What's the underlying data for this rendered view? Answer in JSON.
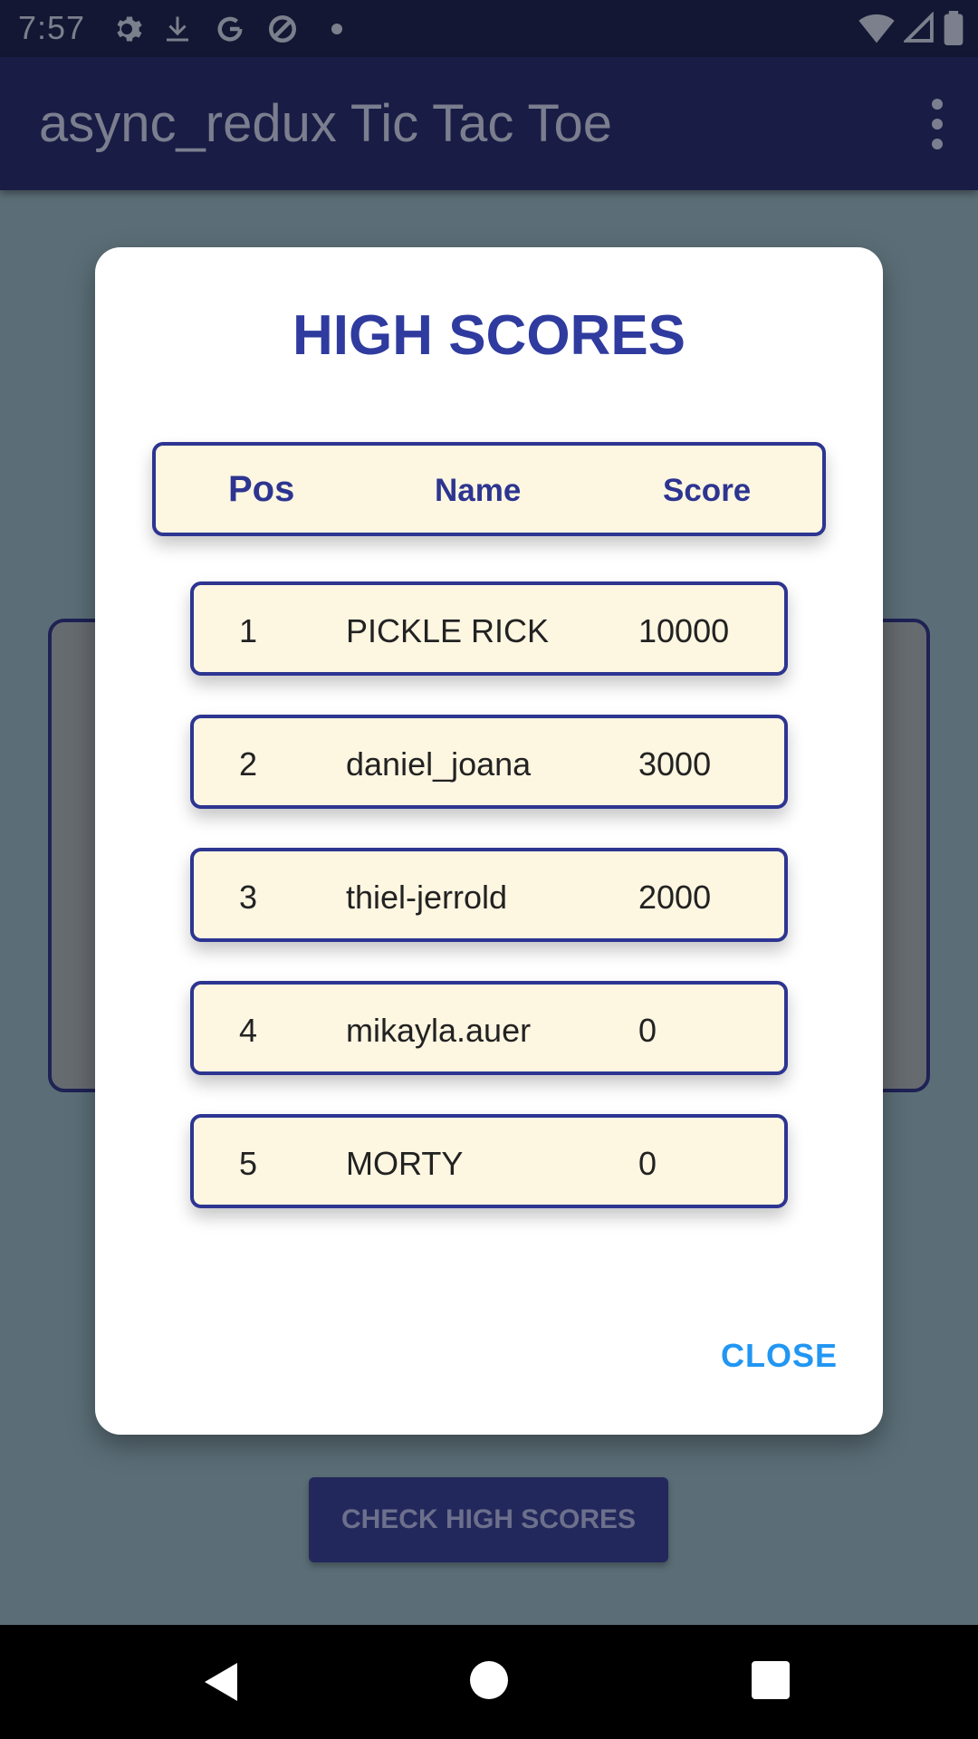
{
  "status_bar": {
    "time": "7:57",
    "left_icons": [
      "gear-icon",
      "download-icon",
      "google-icon",
      "data-saver-icon",
      "dot-icon"
    ],
    "right_icons": [
      "wifi-icon",
      "signal-icon",
      "battery-icon"
    ]
  },
  "app_bar": {
    "title": "async_redux Tic Tac Toe",
    "menu_icon": "more-vert-icon"
  },
  "background": {
    "button_label": "CHECK HIGH SCORES"
  },
  "dialog": {
    "title": "HIGH SCORES",
    "headers": {
      "pos": "Pos",
      "name": "Name",
      "score": "Score"
    },
    "rows": [
      {
        "pos": "1",
        "name": "PICKLE RICK",
        "score": "10000"
      },
      {
        "pos": "2",
        "name": "daniel_joana",
        "score": "3000"
      },
      {
        "pos": "3",
        "name": "thiel-jerrold",
        "score": "2000"
      },
      {
        "pos": "4",
        "name": "mikayla.auer",
        "score": "0"
      },
      {
        "pos": "5",
        "name": "MORTY",
        "score": "0"
      }
    ],
    "close_label": "CLOSE"
  },
  "colors": {
    "primary": "#2d3591",
    "row_background": "#fdf6e1",
    "accent": "#2196f3"
  }
}
